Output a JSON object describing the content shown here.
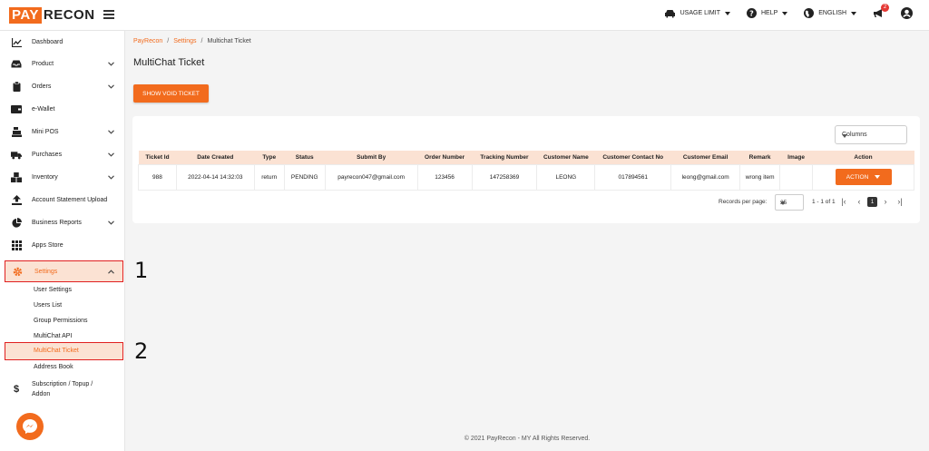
{
  "app": {
    "logo_left": "PAY",
    "logo_right": "RECON"
  },
  "toolbar": {
    "usage_limit": "USAGE LIMIT",
    "help": "HELP",
    "language": "ENGLISH",
    "notification_count": "2"
  },
  "sidebar": {
    "items": [
      {
        "label": "Dashboard",
        "icon": "chart-line-icon"
      },
      {
        "label": "Product",
        "icon": "inbox-icon"
      },
      {
        "label": "Orders",
        "icon": "clipboard-icon"
      },
      {
        "label": "e-Wallet",
        "icon": "wallet-icon"
      },
      {
        "label": "Mini POS",
        "icon": "cash-register-icon"
      },
      {
        "label": "Purchases",
        "icon": "truck-icon"
      },
      {
        "label": "Inventory",
        "icon": "boxes-icon"
      },
      {
        "label": "Account Statement Upload",
        "icon": "upload-icon"
      },
      {
        "label": "Business Reports",
        "icon": "pie-chart-icon"
      },
      {
        "label": "Apps Store",
        "icon": "grid-icon"
      },
      {
        "label": "Settings",
        "icon": "gear-icon"
      }
    ],
    "settings_sub": [
      "User Settings",
      "Users List",
      "Group Permissions",
      "MultiChat API",
      "MultiChat Ticket",
      "Address Book"
    ],
    "subscription_line1": "Subscription / Topup /",
    "subscription_line2": "Addon"
  },
  "annotations": {
    "one": "1",
    "two": "2"
  },
  "breadcrumb": {
    "root": "PayRecon",
    "section": "Settings",
    "current": "Multichat Ticket",
    "sep": "/"
  },
  "page": {
    "title": "MultiChat Ticket",
    "void_button": "SHOW VOID TICKET",
    "columns_select": "Columns"
  },
  "table": {
    "headers": [
      "Ticket Id",
      "Date Created",
      "Type",
      "Status",
      "Submit By",
      "Order Number",
      "Tracking Number",
      "Customer Name",
      "Customer Contact No",
      "Customer Email",
      "Remark",
      "Image",
      "Action"
    ],
    "rows": [
      [
        "988",
        "2022-04-14 14:32:03",
        "return",
        "PENDING",
        "payrecon047@gmail.com",
        "123456",
        "147258369",
        "LEONG",
        "017894561",
        "leong@gmail.com",
        "wrong item",
        "",
        "ACTION"
      ]
    ]
  },
  "pagination": {
    "records_label": "Records per page:",
    "per_page": "25",
    "range": "1 - 1 of 1",
    "current_page": "1"
  },
  "footer": "© 2021 PayRecon - MY All Rights Reserved.",
  "colors": {
    "accent": "#f26b1d",
    "highlight": "#fbe2d3",
    "annotation_box": "#e02020"
  }
}
